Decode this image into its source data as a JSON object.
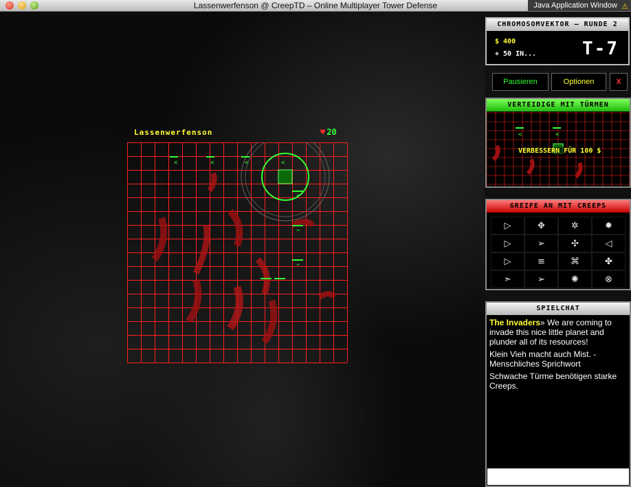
{
  "window": {
    "title": "Lassenwerfenson @ CreepTD – Online Multiplayer Tower Defense",
    "java_tag": "Java Application Window"
  },
  "game": {
    "player_name": "Lassenwerfenson",
    "lives": "20",
    "board": {
      "cols": 16,
      "rows": 16,
      "cell": 20,
      "grid_color": "#ff2020"
    }
  },
  "status": {
    "header": "CHROMOSOMVEKTOR – RUNDE 2",
    "money": "$ 400",
    "income": "+ 50 IN...",
    "timer": "T-7"
  },
  "controls": {
    "pause_label": "Pausieren",
    "options_label": "Optionen",
    "close_label": "X"
  },
  "defend": {
    "header": "VERTEIDIGE MIT TÜRMEN",
    "upgrade_text": "VERBESSERN FÜR 100 $"
  },
  "attack": {
    "header": "GREIFE AN MIT CREEPS",
    "creeps": [
      "▷",
      "✥",
      "✲",
      "✹",
      "▷",
      "➢",
      "✣",
      "◁",
      "▷",
      "≡",
      "⌘",
      "✤",
      "➣",
      "➢",
      "✺",
      "⊗"
    ]
  },
  "chat": {
    "header": "SPIELCHAT",
    "messages": [
      {
        "sender": "The Invaders",
        "text": "» We are coming to invade this nice little planet and plunder all of its resources!"
      },
      {
        "sender": "",
        "text": "Klein Vieh macht auch Mist. -Menschliches Sprichwort"
      },
      {
        "sender": "",
        "text": "Schwache Türme benötigen starke Creeps."
      }
    ],
    "input_value": ""
  },
  "colors": {
    "accent_green": "#33ff33",
    "accent_yellow": "#ffff33",
    "accent_red": "#ff3333"
  }
}
